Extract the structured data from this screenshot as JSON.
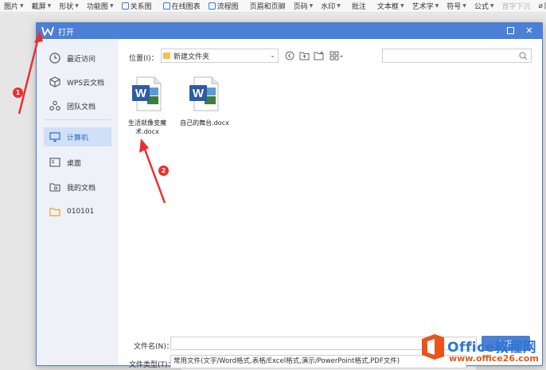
{
  "ribbon": {
    "items": [
      "图片",
      "截屏",
      "形状",
      "功能图",
      "关系图",
      "在线图表",
      "流程图",
      "页眉和页脚",
      "页码",
      "水印",
      "批注",
      "文本框",
      "艺术字",
      "符号",
      "公式",
      "首字下沉",
      "附件"
    ]
  },
  "dialog": {
    "title": "打开",
    "sidebar": [
      {
        "label": "最近访问",
        "icon": "clock-icon"
      },
      {
        "label": "WPS云文档",
        "icon": "cube-icon"
      },
      {
        "label": "团队文档",
        "icon": "team-icon"
      },
      {
        "label": "计算机",
        "icon": "monitor-icon"
      },
      {
        "label": "桌面",
        "icon": "desktop-icon"
      },
      {
        "label": "我的文档",
        "icon": "documents-icon"
      },
      {
        "label": "010101",
        "icon": "folder-icon"
      }
    ],
    "location_label": "位置(I)：",
    "location_value": "新建文件夹",
    "files": [
      {
        "name": "生活就像变魔术.docx"
      },
      {
        "name": "自己的舞台.docx"
      }
    ],
    "filename_label": "文件名(N)：",
    "filename_value": "",
    "open_button": "打开",
    "filetype_label": "文件类型(T)：",
    "filetype_value": "常用文件(文字/Word格式,表格/Excel格式,演示/PowerPoint格式,PDF文件)"
  },
  "annotations": [
    "1",
    "2"
  ],
  "watermark": {
    "text": "Office教程网",
    "url": "www.office26.com"
  },
  "colors": {
    "accent": "#4a80d6",
    "annotation": "#e8312f",
    "sidebar_bg": "#eef1f7",
    "sidebar_active": "#cfe0f7"
  }
}
